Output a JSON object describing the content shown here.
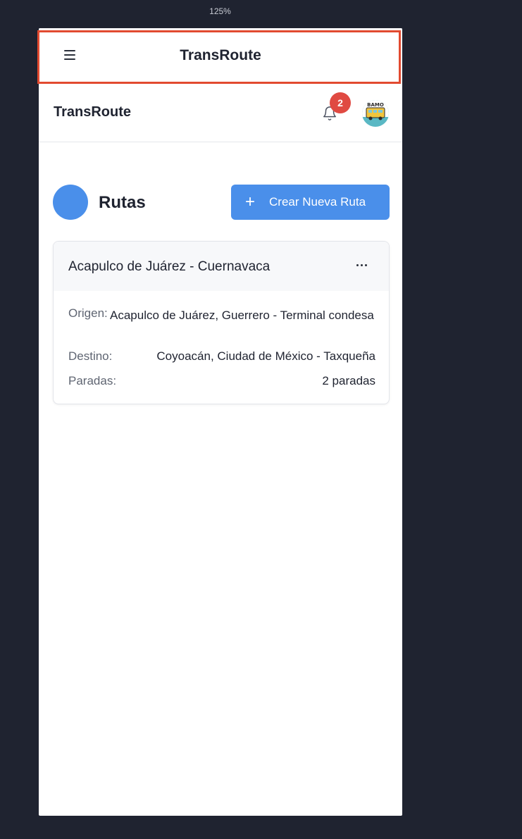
{
  "zoom": "125%",
  "topbar": {
    "title": "TransRoute"
  },
  "header": {
    "brand": "TransRoute",
    "notification_count": "2"
  },
  "section": {
    "title": "Rutas",
    "create_label": "Crear Nueva Ruta",
    "create_icon": "+"
  },
  "route_card": {
    "title": "Acapulco de Juárez - Cuernavaca",
    "fields": [
      {
        "label": "Origen:",
        "value": "Acapulco de Juárez, Guerrero - Terminal condesa"
      },
      {
        "label": "Destino:",
        "value": "Coyoacán, Ciudad de México - Taxqueña"
      },
      {
        "label": "Paradas:",
        "value": "2 paradas"
      }
    ]
  },
  "avatar": {
    "logo_text": "BAMO"
  },
  "colors": {
    "accent": "#4a8fea",
    "badge": "#e04a42",
    "highlight": "#e24a30",
    "background": "#1f2330"
  }
}
